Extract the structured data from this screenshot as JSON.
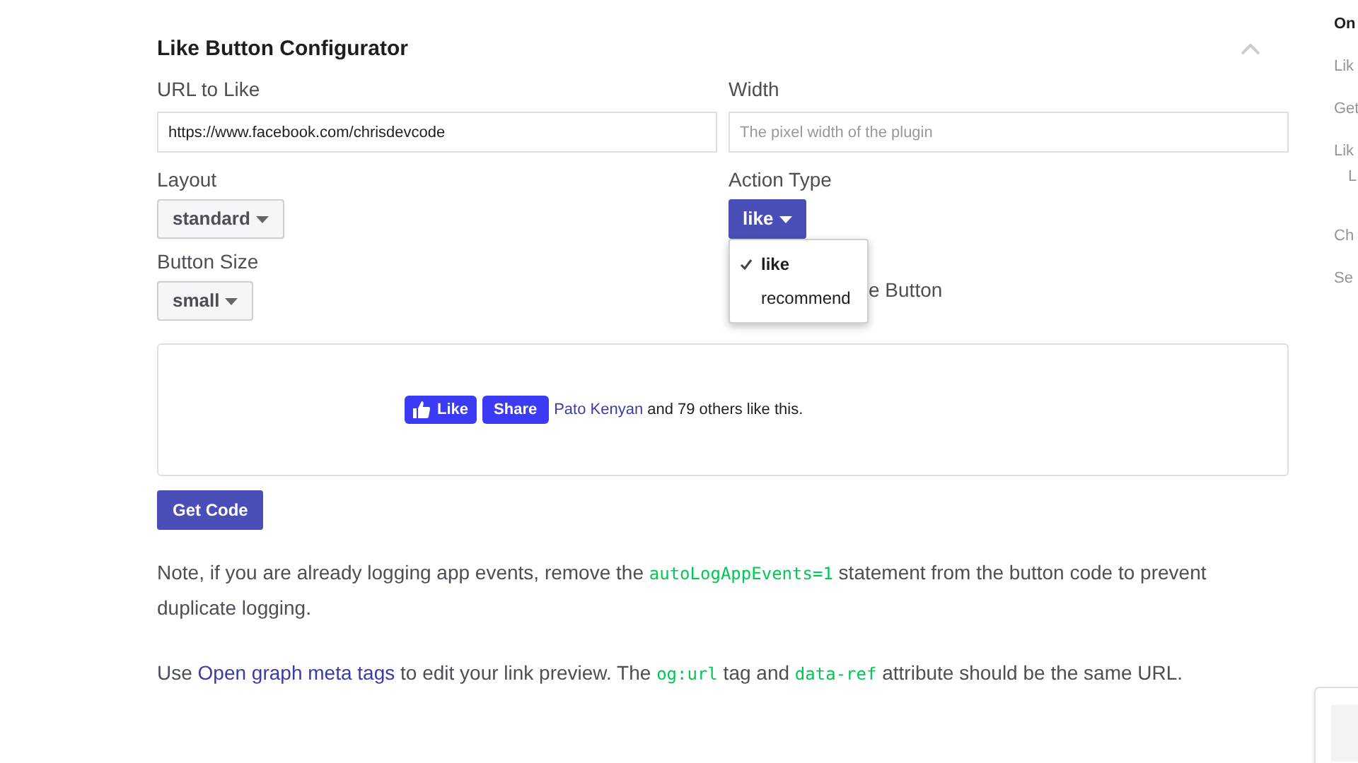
{
  "section": {
    "title": "Like Button Configurator"
  },
  "fields": {
    "url": {
      "label": "URL to Like",
      "value": "https://www.facebook.com/chrisdevcode"
    },
    "width": {
      "label": "Width",
      "placeholder": "The pixel width of the plugin"
    }
  },
  "layout": {
    "label": "Layout",
    "value": "standard"
  },
  "action_type": {
    "label": "Action Type",
    "value": "like",
    "expanded": true,
    "options": [
      {
        "label": "like",
        "selected": true
      },
      {
        "label": "recommend",
        "selected": false
      }
    ]
  },
  "button_size": {
    "label": "Button Size",
    "value": "small"
  },
  "share_option": {
    "label": "e Button"
  },
  "preview": {
    "like": "Like",
    "share": "Share",
    "friend": "Pato Kenyan",
    "text": "and 79 others like this."
  },
  "get_code": "Get Code",
  "paragraphs": [
    [
      {
        "kind": "text",
        "text": "Note, if you are already logging app events, remove the "
      },
      {
        "kind": "code",
        "text": "autoLogAppEvents=1"
      },
      {
        "kind": "text",
        "text": " statement from the button code to prevent duplicate logging."
      }
    ],
    [
      {
        "kind": "text",
        "text": "Use "
      },
      {
        "kind": "link",
        "text": "Open graph meta tags"
      },
      {
        "kind": "text",
        "text": " to edit your link preview. The "
      },
      {
        "kind": "code",
        "text": "og:url"
      },
      {
        "kind": "text",
        "text": " tag and "
      },
      {
        "kind": "code",
        "text": "data-ref"
      },
      {
        "kind": "text",
        "text": " attribute should be the same URL."
      }
    ]
  ],
  "sidebar": {
    "items": [
      {
        "label": "On",
        "selected": true
      },
      {
        "label": "Lik",
        "selected": false
      },
      {
        "label": "Get",
        "selected": false
      },
      {
        "label": "Lik",
        "selected": false,
        "children": [
          {
            "label": "L",
            "selected": false
          }
        ]
      },
      {
        "label": "Ch",
        "selected": false
      },
      {
        "label": "Se",
        "selected": false
      }
    ]
  }
}
